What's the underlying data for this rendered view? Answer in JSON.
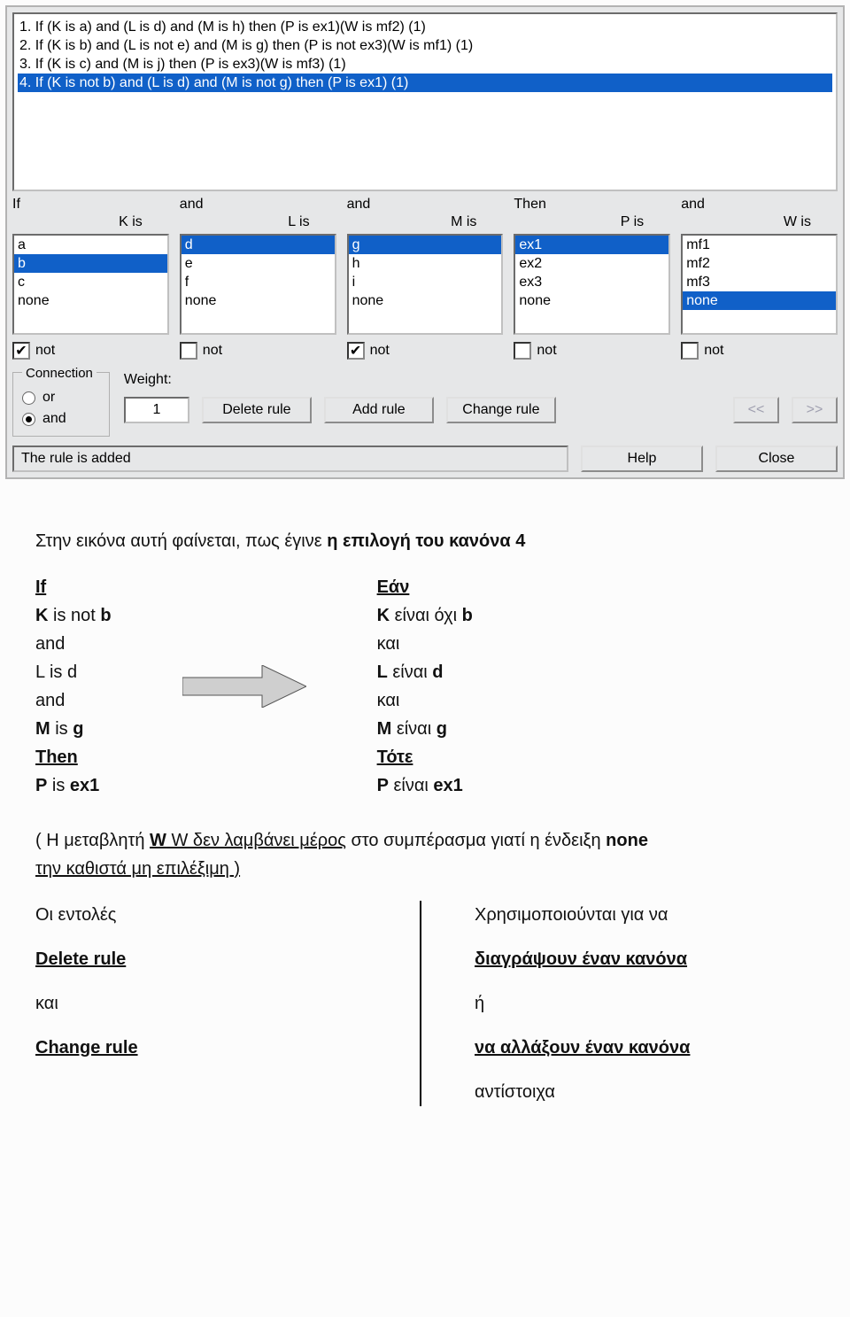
{
  "ruleList": {
    "items": [
      "1. If (K is a) and (L is d) and (M is h) then (P is ex1)(W is mf2) (1)",
      "2. If (K is b) and (L is not e) and (M is g) then (P is not ex3)(W is mf1) (1)",
      "3. If (K is c) and (M is j) then (P is ex3)(W is mf3) (1)",
      "4. If (K is not b) and (L is d) and (M is not g) then (P is ex1) (1)"
    ],
    "selected": 3
  },
  "cols": [
    {
      "top": "If",
      "var": "K is",
      "items": [
        "a",
        "b",
        "c",
        "none"
      ],
      "sel": 1,
      "not": true
    },
    {
      "top": "and",
      "var": "L is",
      "items": [
        "d",
        "e",
        "f",
        "none"
      ],
      "sel": 0,
      "not": false
    },
    {
      "top": "and",
      "var": "M is",
      "items": [
        "g",
        "h",
        "i",
        "none"
      ],
      "sel": 0,
      "not": true
    },
    {
      "top": "Then",
      "var": "P is",
      "items": [
        "ex1",
        "ex2",
        "ex3",
        "none"
      ],
      "sel": 0,
      "not": false
    },
    {
      "top": "and",
      "var": "W is",
      "items": [
        "mf1",
        "mf2",
        "mf3",
        "none"
      ],
      "sel": 3,
      "not": false
    }
  ],
  "notLabel": "not",
  "connection": {
    "label": "Connection",
    "or": "or",
    "and": "and",
    "selected": "and"
  },
  "weight": {
    "label": "Weight:",
    "value": "1"
  },
  "buttons": {
    "delete": "Delete rule",
    "add": "Add rule",
    "change": "Change rule",
    "prev": "<<",
    "next": ">>",
    "help": "Help",
    "close": "Close"
  },
  "status": "The rule is added",
  "doc": {
    "intro_a": "Στην εικόνα αυτή φαίνεται, πως έγινε ",
    "intro_b": "η επιλογή του κανόνα 4",
    "en": {
      "if": "If",
      "l1a": "K",
      " l1b": " is not ",
      "l1c": "b",
      "l2": "and",
      "l3": "L is d",
      "l4": "and",
      "l5a": "M",
      "l5b": " is ",
      "l5c": "g",
      "then": "Then",
      "l6a": "P",
      "l6b": " is ",
      "l6c": "ex1"
    },
    "gr": {
      "if": "Εάν",
      "l1a": "K",
      "l1b": " είναι όχι ",
      "l1c": "b",
      "l2": "και",
      "l3a": "L",
      "l3b": " είναι ",
      "l3c": "d",
      "l4": "και",
      "l5a": "M",
      "l5b": " είναι ",
      "l5c": "g",
      "then": "Τότε",
      "l6a": "P",
      "l6b": " είναι ",
      "l6c": "ex1"
    },
    "note_a": "( Η μεταβλητή ",
    "note_b": "W δεν λαμβάνει μέρος",
    "note_c": " στο συμπέρασμα γιατί η ένδειξη ",
    "note_d": "none",
    "note_e": "την καθιστά μη επιλέξιμη )",
    "cmds": {
      "l1a": "Οι εντολές",
      "l1b": "Χρησιμοποιούνται  για να",
      "l2a": "Delete rule",
      "l2b": "διαγράψουν έναν κανόνα",
      "l3a": "και",
      "l3b": "ή",
      "l4a": "Change rule",
      "l4b": "να αλλάξουν έναν κανόνα",
      "l5": "αντίστοιχα"
    }
  }
}
